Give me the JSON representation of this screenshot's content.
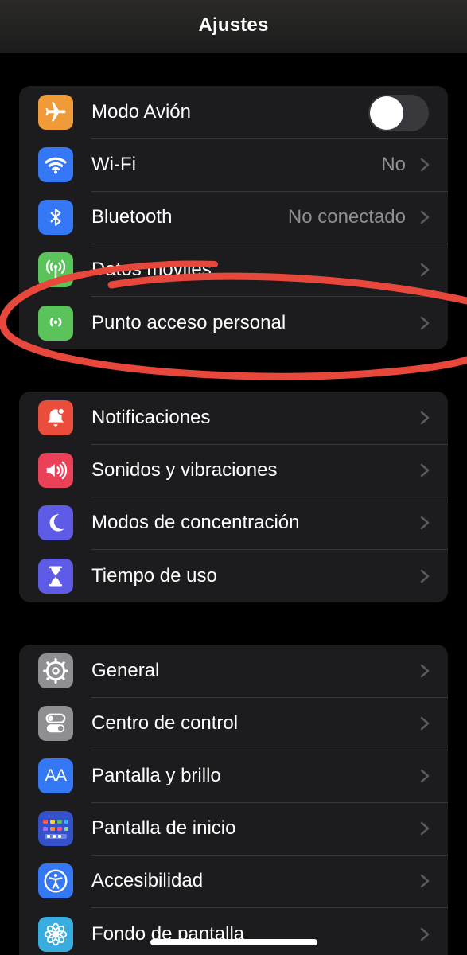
{
  "navbar": {
    "title": "Ajustes"
  },
  "groups": [
    {
      "items": [
        {
          "label": "Modo Avión",
          "icon": "airplane-icon",
          "color": "#f19a38",
          "toggle": false
        },
        {
          "label": "Wi-Fi",
          "value": "No",
          "icon": "wifi-icon",
          "color": "#3478f6"
        },
        {
          "label": "Bluetooth",
          "value": "No conectado",
          "icon": "bluetooth-icon",
          "color": "#3478f6"
        },
        {
          "label": "Datos móviles",
          "icon": "antenna-icon",
          "color": "#5ac45a"
        },
        {
          "label": "Punto acceso personal",
          "icon": "hotspot-icon",
          "color": "#5ac45a"
        }
      ]
    },
    {
      "items": [
        {
          "label": "Notificaciones",
          "icon": "bell-icon",
          "color": "#eb4d3d"
        },
        {
          "label": "Sonidos y vibraciones",
          "icon": "speaker-icon",
          "color": "#ea4159"
        },
        {
          "label": "Modos de concentración",
          "icon": "moon-icon",
          "color": "#5e5ce6"
        },
        {
          "label": "Tiempo de uso",
          "icon": "hourglass-icon",
          "color": "#5e5ce6"
        }
      ]
    },
    {
      "items": [
        {
          "label": "General",
          "icon": "gear-icon",
          "color": "#8e8e93"
        },
        {
          "label": "Centro de control",
          "icon": "switches-icon",
          "color": "#8e8e93"
        },
        {
          "label": "Pantalla y brillo",
          "icon": "text-size-icon",
          "icon_text": "AA",
          "color": "#3478f6"
        },
        {
          "label": "Pantalla de inicio",
          "icon": "app-grid-icon",
          "color": "#3451c9"
        },
        {
          "label": "Accesibilidad",
          "icon": "accessibility-icon",
          "color": "#3478f6"
        },
        {
          "label": "Fondo de pantalla",
          "icon": "flower-icon",
          "color": "#38aee0"
        }
      ]
    }
  ],
  "annotation": {
    "shape": "hand-drawn ellipse",
    "color": "#e8473b"
  }
}
